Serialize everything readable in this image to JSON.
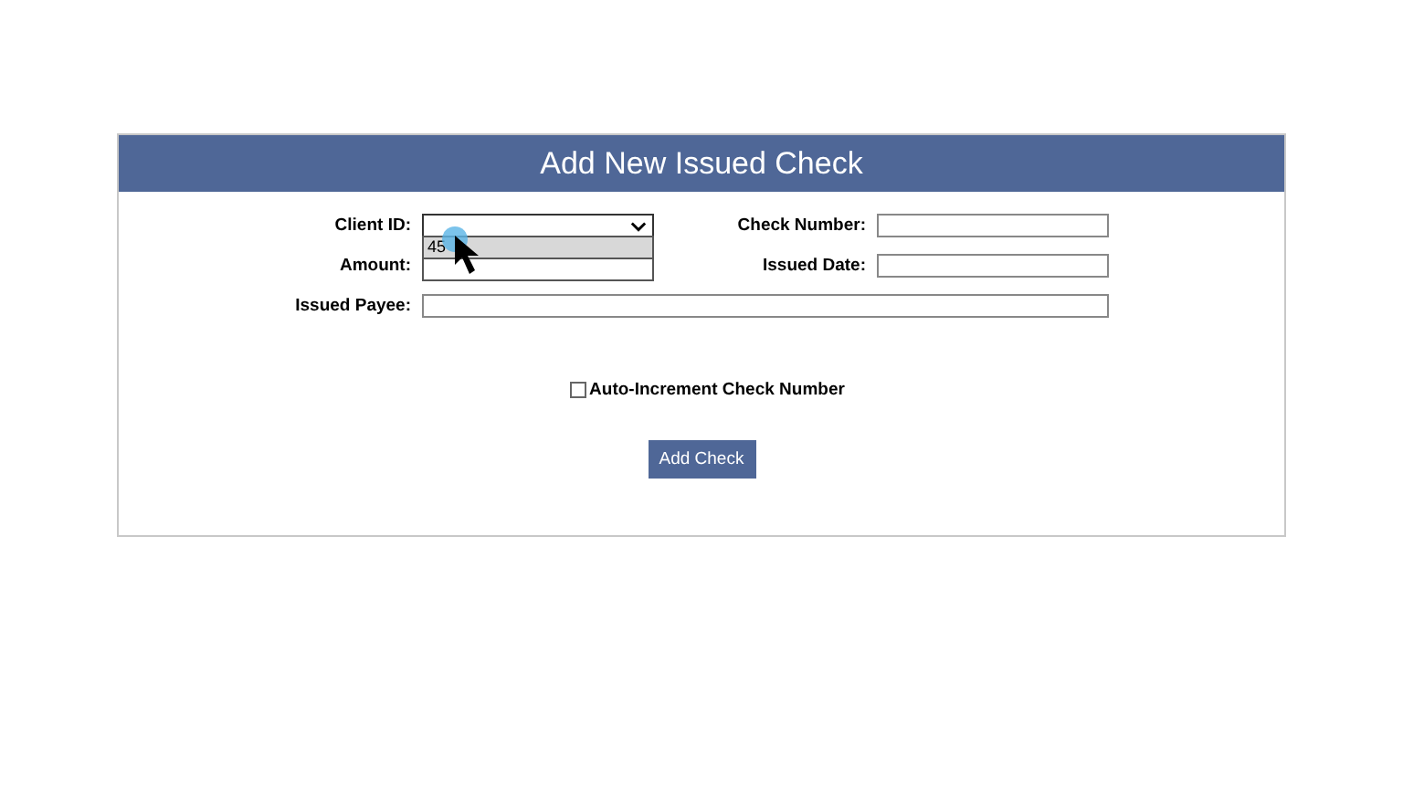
{
  "form": {
    "title": "Add New Issued Check",
    "fields": [
      {
        "label": "Client ID:",
        "kind": "select",
        "expanded": true,
        "options": [
          {
            "text": "45",
            "selected": true
          }
        ]
      },
      {
        "label": "Check Number:",
        "kind": "text"
      },
      {
        "label": "Amount:",
        "kind": "text"
      },
      {
        "label": "Issued Date:",
        "kind": "text"
      },
      {
        "label": "Issued Payee:",
        "kind": "wide"
      }
    ],
    "checkbox": {
      "label": "Auto-Increment Check Number",
      "checked": false
    },
    "button": "Add Check"
  }
}
